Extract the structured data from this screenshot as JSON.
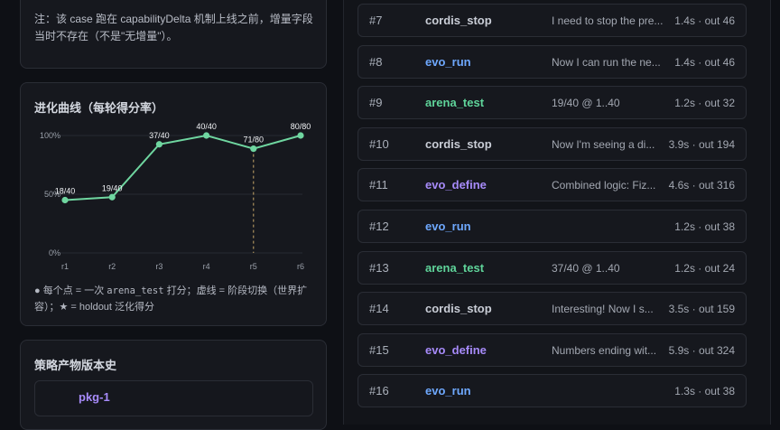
{
  "note": {
    "text": "注：该 case 跑在 capabilityDelta 机制上线之前，增量字段当时不存在（不是\"无增量\"）。"
  },
  "evolution": {
    "title": "进化曲线（每轮得分率）",
    "legend_part1": "● 每个点 = 一次 ",
    "legend_code": "arena_test",
    "legend_part2": " 打分；虚线 = 阶段切换（世界扩容）；★ = holdout 泛化得分"
  },
  "chart_data": {
    "type": "line",
    "title": "进化曲线（每轮得分率）",
    "categories": [
      "r1",
      "r2",
      "r3",
      "r4",
      "r5",
      "r6"
    ],
    "values": [
      45,
      47.5,
      92.5,
      100,
      88.75,
      100
    ],
    "labels": [
      "18/40",
      "19/40",
      "37/40",
      "40/40",
      "71/80",
      "80/80"
    ],
    "ylim": [
      0,
      100
    ],
    "yticks": [
      "0%",
      "50%",
      "100%"
    ],
    "phase_switch_at": "r5",
    "line_color": "#6fd6a0",
    "grid": true
  },
  "history": {
    "title": "策略产物版本史",
    "items": [
      {
        "label": "pkg-1"
      }
    ]
  },
  "colors": {
    "cordis_stop": "#c9cdd6",
    "evo_run": "#6ea8fe",
    "arena_test": "#5fd49a",
    "evo_define": "#a78bfa"
  },
  "runs": [
    {
      "num": "#7",
      "tool": "cordis_stop",
      "msg": "I need to stop the pre...",
      "stat": "1.4s · out 46"
    },
    {
      "num": "#8",
      "tool": "evo_run",
      "msg": "Now I can run the ne...",
      "stat": "1.4s · out 46"
    },
    {
      "num": "#9",
      "tool": "arena_test",
      "msg": "19/40 @ 1..40",
      "stat": "1.2s · out 32"
    },
    {
      "num": "#10",
      "tool": "cordis_stop",
      "msg": "Now I'm seeing a di...",
      "stat": "3.9s · out 194"
    },
    {
      "num": "#11",
      "tool": "evo_define",
      "msg": "Combined logic: Fiz...",
      "stat": "4.6s · out 316"
    },
    {
      "num": "#12",
      "tool": "evo_run",
      "msg": "",
      "stat": "1.2s · out 38"
    },
    {
      "num": "#13",
      "tool": "arena_test",
      "msg": "37/40 @ 1..40",
      "stat": "1.2s · out 24"
    },
    {
      "num": "#14",
      "tool": "cordis_stop",
      "msg": "Interesting! Now I s...",
      "stat": "3.5s · out 159"
    },
    {
      "num": "#15",
      "tool": "evo_define",
      "msg": "Numbers ending wit...",
      "stat": "5.9s · out 324"
    },
    {
      "num": "#16",
      "tool": "evo_run",
      "msg": "",
      "stat": "1.3s · out 38"
    }
  ]
}
